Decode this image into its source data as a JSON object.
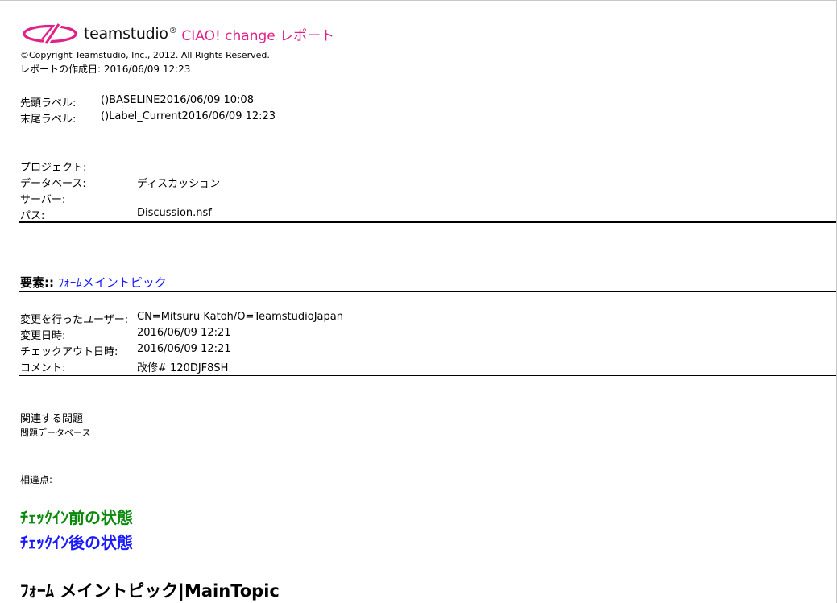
{
  "header": {
    "brand_name": "teamstudio",
    "reg_mark": "®",
    "report_title": "CIAO! change レポート",
    "copyright": "©Copyright Teamstudio, Inc., 2012. All Rights Reserved.",
    "created_label": "レポートの作成日:",
    "created_value": "2016/06/09 12:23",
    "logo_color": "#e0218a"
  },
  "labels": {
    "first_label": "先頭ラベル:",
    "first_value": "()BASELINE2016/06/09 10:08",
    "last_label": "末尾ラベル:",
    "last_value": "()Label_Current2016/06/09 12:23"
  },
  "project_info": {
    "project_label": "プロジェクト:",
    "project_value": "",
    "database_label": "データベース:",
    "database_value": "ディスカッション",
    "server_label": "サーバー:",
    "server_value": "",
    "path_label": "パス:",
    "path_value": "Discussion.nsf"
  },
  "element": {
    "label": "要素::",
    "value": "ﾌｫｰﾑメイントピック",
    "value_color": "#1a1aff"
  },
  "change_info": {
    "user_label": "変更を行ったユーザー:",
    "user_value": "CN=Mitsuru Katoh/O=TeamstudioJapan",
    "date_label": "変更日時:",
    "date_value": "2016/06/09 12:21",
    "checkout_label": "チェックアウト日時:",
    "checkout_value": "2016/06/09 12:21",
    "comment_label": "コメント:",
    "comment_value": "改修# 120DJF8SH"
  },
  "issues": {
    "link": "関連する問題",
    "database_label": "問題データベース"
  },
  "differences": {
    "label": "相違点:",
    "before": "ﾁｪｯｸｲﾝ前の状態",
    "before_color": "#0b8a0b",
    "after": "ﾁｪｯｸｲﾝ後の状態",
    "after_color": "#1a1aff"
  },
  "form_title": "ﾌｫｰﾑ メイントピック|MainTopic"
}
